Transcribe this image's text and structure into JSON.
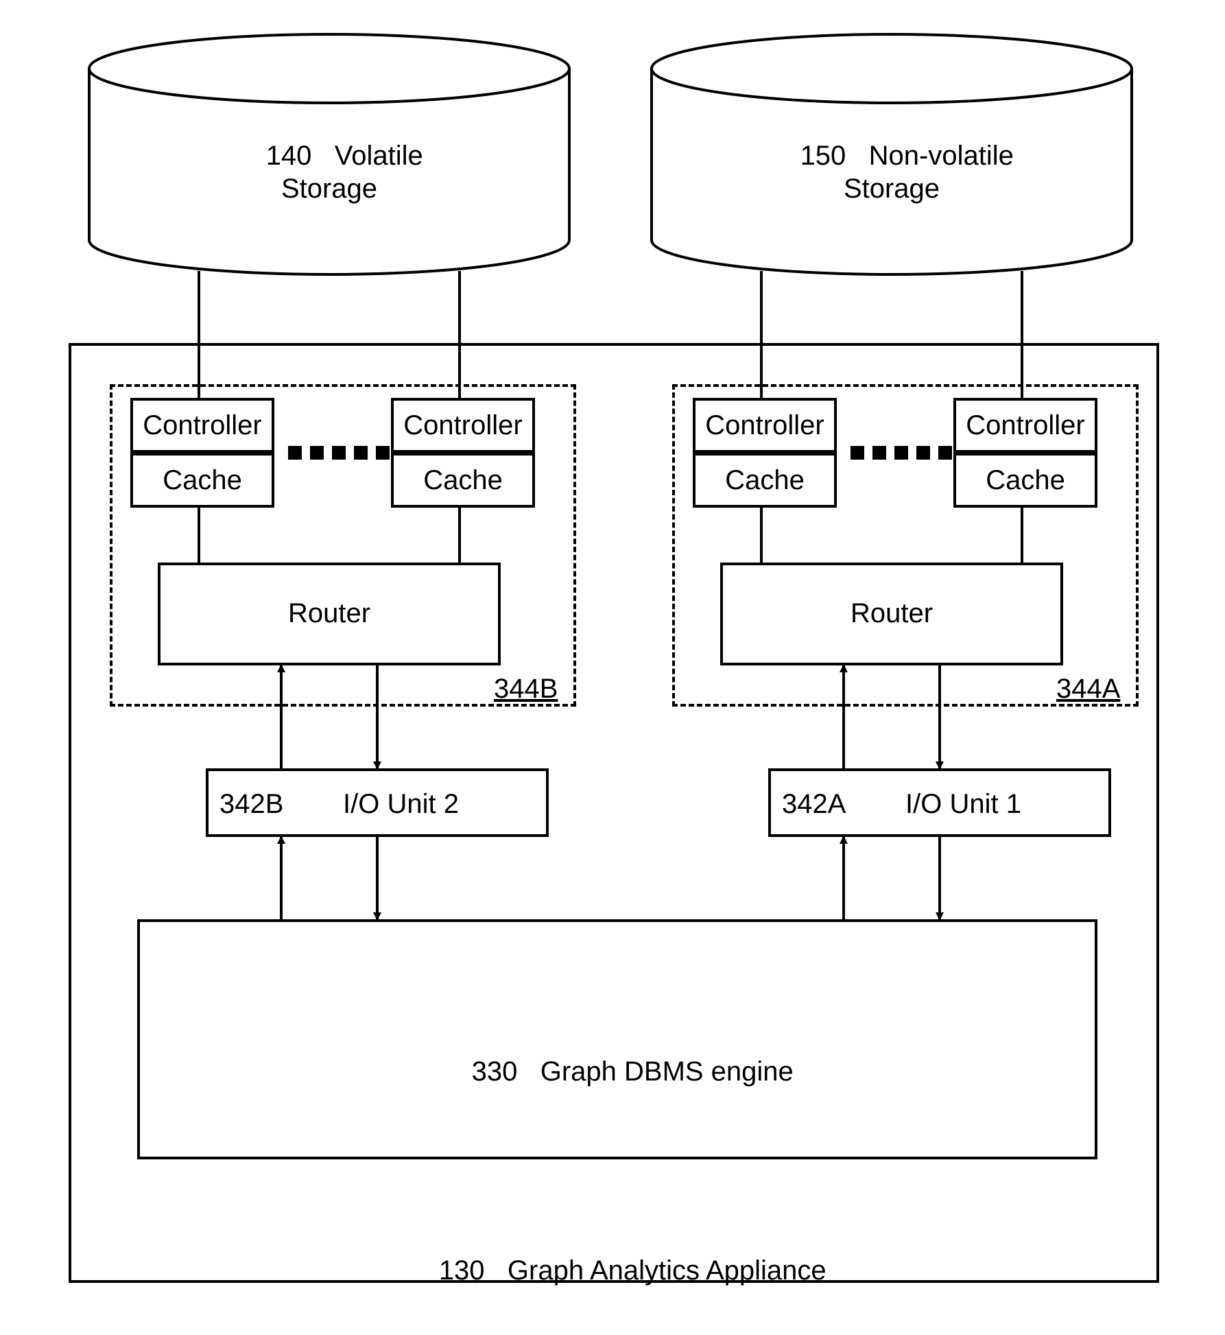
{
  "storage": {
    "volatile": {
      "num": "140",
      "label": "Volatile\nStorage"
    },
    "nonvolatile": {
      "num": "150",
      "label": "Non-volatile\nStorage"
    }
  },
  "appliance": {
    "num": "130",
    "label": "Graph Analytics Appliance"
  },
  "engine": {
    "num": "330",
    "label": "Graph DBMS engine"
  },
  "io": {
    "left": {
      "num": "342B",
      "label": "I/O Unit 2"
    },
    "right": {
      "num": "342A",
      "label": "I/O Unit 1"
    }
  },
  "group": {
    "left": {
      "tag": "344B"
    },
    "right": {
      "tag": "344A"
    }
  },
  "router": {
    "label": "Router"
  },
  "controller": {
    "top": "Controller",
    "bottom": "Cache"
  }
}
